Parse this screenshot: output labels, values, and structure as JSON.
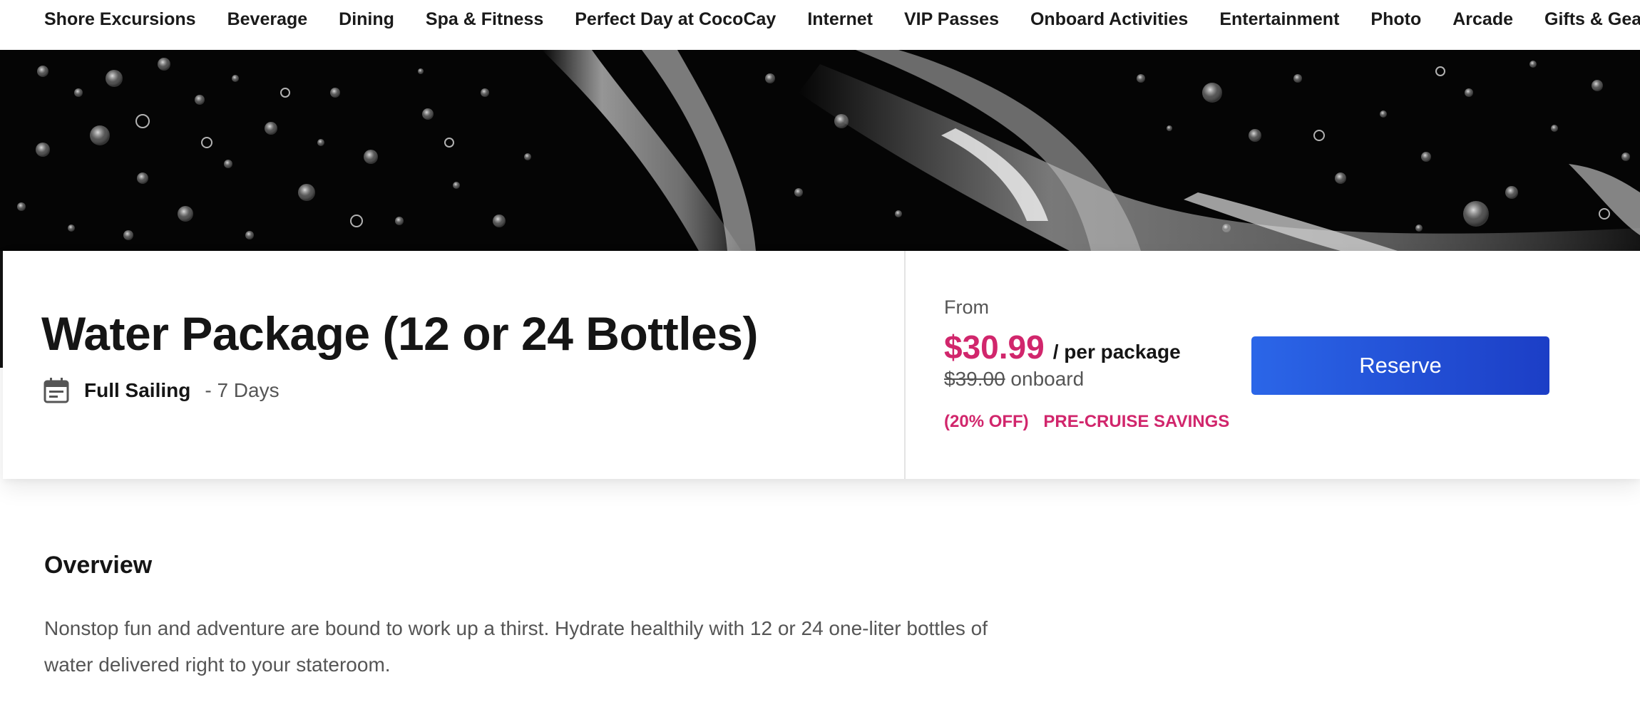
{
  "nav": {
    "items": [
      {
        "label": "Shore Excursions"
      },
      {
        "label": "Beverage"
      },
      {
        "label": "Dining"
      },
      {
        "label": "Spa & Fitness"
      },
      {
        "label": "Perfect Day at CocoCay"
      },
      {
        "label": "Internet"
      },
      {
        "label": "VIP Passes"
      },
      {
        "label": "Onboard Activities"
      },
      {
        "label": "Entertainment"
      },
      {
        "label": "Photo"
      },
      {
        "label": "Arcade"
      },
      {
        "label": "Gifts & Gear"
      }
    ]
  },
  "hero": {
    "subject": "water splash on black background"
  },
  "product": {
    "title": "Water Package (12 or 24 Bottles)",
    "sailing_label": "Full Sailing",
    "sailing_duration": "- 7 Days",
    "calendar_icon": "calendar-icon"
  },
  "pricing": {
    "from_label": "From",
    "price": "$30.99",
    "unit": "/ per package",
    "old_price": "$39.00",
    "old_suffix": "onboard",
    "discount": "(20% OFF)",
    "savings_label": "PRE-CRUISE SAVINGS",
    "reserve_label": "Reserve"
  },
  "overview": {
    "title": "Overview",
    "text": "Nonstop fun and adventure are bound to work up a thirst. Hydrate healthily with 12 or 24 one-liter bottles of water delivered right to your stateroom."
  },
  "colors": {
    "accent_price": "#d1266c",
    "button": "#2b66e8",
    "hero_bg": "#050505"
  }
}
